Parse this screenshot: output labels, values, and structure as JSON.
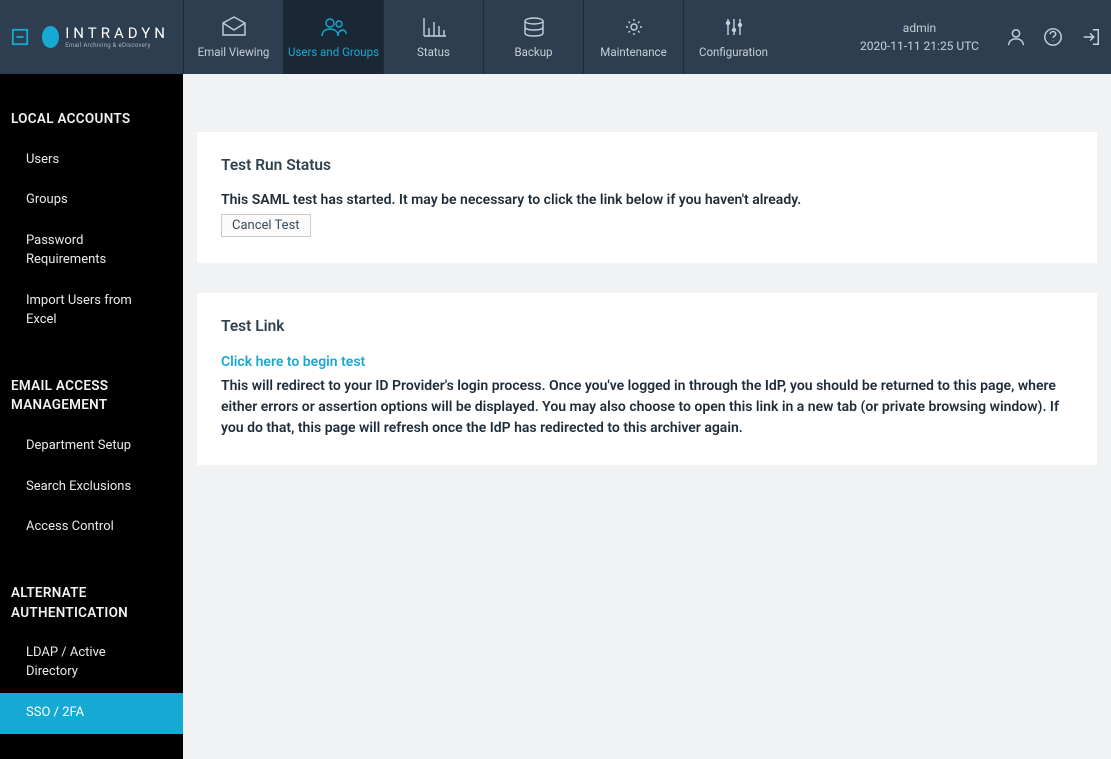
{
  "brand": {
    "name": "INTRADYN",
    "tagline": "Email Archiving & eDiscovery"
  },
  "nav": {
    "email_viewing": "Email Viewing",
    "users_groups": "Users and Groups",
    "status": "Status",
    "backup": "Backup",
    "maintenance": "Maintenance",
    "configuration": "Configuration"
  },
  "user": {
    "name": "admin",
    "timestamp": "2020-11-11 21:25 UTC"
  },
  "sidebar": {
    "sections": [
      {
        "title": "LOCAL ACCOUNTS",
        "items": [
          "Users",
          "Groups",
          "Password Requirements",
          "Import Users from Excel"
        ]
      },
      {
        "title": "EMAIL ACCESS MANAGEMENT",
        "items": [
          "Department Setup",
          "Search Exclusions",
          "Access Control"
        ]
      },
      {
        "title": "ALTERNATE AUTHENTICATION",
        "items": [
          "LDAP / Active Directory",
          "SSO / 2FA"
        ]
      }
    ]
  },
  "panel1": {
    "title": "Test Run Status",
    "message": "This SAML test has started. It may be necessary to click the link below if you haven't already.",
    "cancel_label": "Cancel Test"
  },
  "panel2": {
    "title": "Test Link",
    "link_text": "Click here to begin test",
    "description": "This will redirect to your ID Provider's login process. Once you've logged in through the IdP, you should be returned to this page, where either errors or assertion options will be displayed. You may also choose to open this link in a new tab (or private browsing window). If you do that, this page will refresh once the IdP has redirected to this archiver again."
  }
}
